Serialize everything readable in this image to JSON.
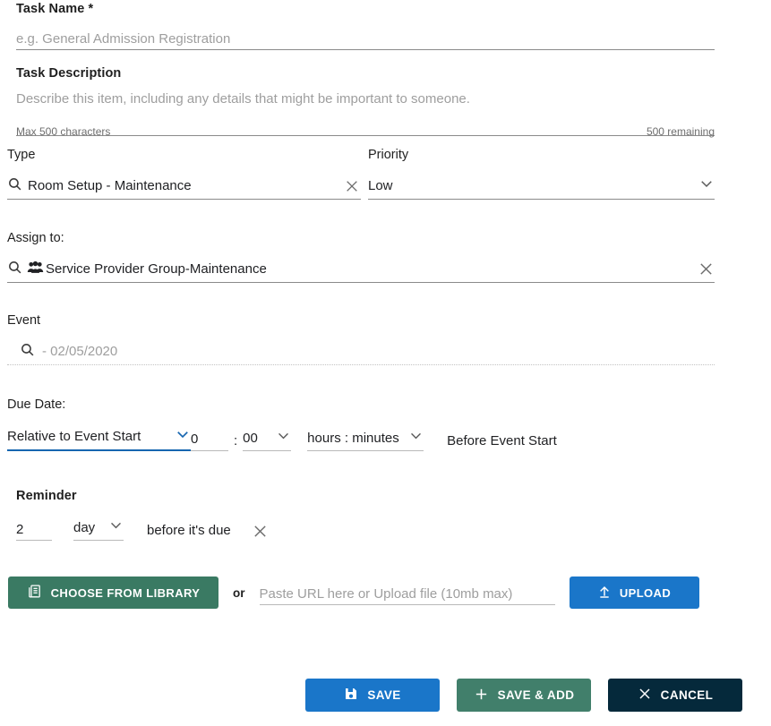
{
  "task_name": {
    "label": "Task Name *",
    "placeholder": "e.g. General Admission Registration",
    "value": ""
  },
  "task_description": {
    "label": "Task Description",
    "placeholder": "Describe this item, including any details that might be important to someone.",
    "value": "",
    "max_hint": "Max 500 characters",
    "remaining": "500 remaining"
  },
  "type": {
    "label": "Type",
    "value": "Room Setup - Maintenance",
    "search_icon": "search-icon",
    "clear_icon": "close-icon"
  },
  "priority": {
    "label": "Priority",
    "value": "Low",
    "chevron_icon": "chevron-down-icon"
  },
  "assign_to": {
    "label": "Assign to:",
    "value": "Service Provider Group-Maintenance",
    "search_icon": "search-icon",
    "group_icon": "group-icon",
    "clear_icon": "close-icon"
  },
  "event": {
    "label": "Event",
    "placeholder": "- 02/05/2020",
    "value": "",
    "search_icon": "search-icon"
  },
  "due_date": {
    "label": "Due Date:",
    "mode": "Relative to Event Start",
    "hours": "0",
    "separator": ":",
    "minutes": "00",
    "unit": "hours : minutes",
    "suffix": "Before Event Start",
    "chevron_icon": "chevron-down-icon"
  },
  "reminder": {
    "label": "Reminder",
    "amount": "2",
    "unit": "day",
    "text": "before it's due",
    "clear_icon": "close-icon",
    "chevron_icon": "chevron-down-icon"
  },
  "attachment": {
    "choose_library_label": "CHOOSE FROM LIBRARY",
    "library_icon": "library-book-icon",
    "or_label": "or",
    "url_placeholder": "Paste URL here or Upload file (10mb max)",
    "url_value": "",
    "upload_label": "UPLOAD",
    "upload_icon": "upload-arrow-icon"
  },
  "footer": {
    "save_label": "SAVE",
    "save_icon": "floppy-disk-icon",
    "save_add_label": "SAVE & ADD",
    "save_add_icon": "plus-icon",
    "cancel_label": "CANCEL",
    "cancel_icon": "close-icon"
  },
  "colors": {
    "primary_blue": "#1a76c9",
    "focus_blue": "#1666b0",
    "library_green": "#3a7a63",
    "save_add_green": "#417f6b",
    "cancel_navy": "#05293b",
    "placeholder_grey": "#9e9e9e"
  }
}
